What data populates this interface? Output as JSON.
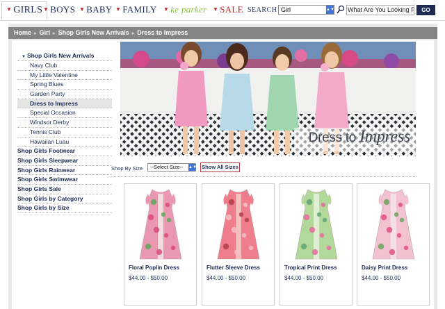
{
  "topnav": {
    "items": [
      {
        "label": "GIRLS",
        "arrow": "▼"
      },
      {
        "label": "BOYS",
        "arrow": "▼"
      },
      {
        "label": "BABY",
        "arrow": "▼"
      },
      {
        "label": "FAMILY",
        "arrow": "▼"
      },
      {
        "label": "ke parker",
        "arrow": "▼"
      },
      {
        "label": "SALE",
        "arrow": "▼"
      }
    ],
    "search_label": "SEARCH",
    "search_scope": "Girl",
    "search_placeholder": "What Are You Looking For?",
    "go_label": "GO"
  },
  "breadcrumb": [
    "Home",
    "Girl",
    "Shop Girls New Arrivals",
    "Dress to Impress"
  ],
  "breadcrumb_sep": "▸",
  "sidebar": {
    "section": {
      "label": "Shop Girls New Arrivals",
      "arrow": "▼"
    },
    "subitems": [
      "Navy Club",
      "My Little Valentine",
      "Spring Blues",
      "Garden Party",
      "Dress to Impress",
      "Special Occasion",
      "Windsor Derby",
      "Tennis Club",
      "Hawaiian Luau"
    ],
    "active": "Dress to Impress",
    "top_items": [
      "Shop Girls Footwear",
      "Shop Girls Sleepwear",
      "Shop Girls Rainwear",
      "Shop Girls Swimwear",
      "Shop Girls Sale",
      "Shop Girls by Category",
      "Shop Girls by Size"
    ]
  },
  "banner": {
    "title_plain": "Dress to ",
    "title_script": "Impress"
  },
  "size_filter": {
    "label": "Shop By Size",
    "select_value": "--Select Size--",
    "show_all_label": "Show All Sizes"
  },
  "products": [
    {
      "name": "Floral Poplin Dress",
      "price": "$44.00 - $50.00",
      "main": "#ea97b3",
      "accent": "#5fa85a",
      "pattern": "#d94b7e",
      "panel": "#f3e6e6"
    },
    {
      "name": "Flutter Sleeve Dress",
      "price": "$44.00 - $50.00",
      "main": "#f07d8b",
      "accent": "#b23c4a",
      "pattern": "#f6c0c5",
      "panel": "#f4c9c6"
    },
    {
      "name": "Tropical Print Dress",
      "price": "$44.00 - $50.00",
      "main": "#b3d99a",
      "accent": "#5ea374",
      "pattern": "#e56aa0",
      "panel": "#e7f2da"
    },
    {
      "name": "Daisy Print Dress",
      "price": "$44.00 - $50.00",
      "main": "#f2c2d0",
      "accent": "#6fa45c",
      "pattern": "#e05184",
      "panel": "#f6e4ea"
    }
  ],
  "colors": {
    "navy": "#1d2b52",
    "red": "#c4222e",
    "green": "#8ac43f",
    "breadcrumb_bg": "#848484",
    "frame_bg": "#e9e9e9"
  },
  "icons": [
    "search-icon",
    "dropdown-arrow-icon",
    "nav-arrow-icon"
  ]
}
